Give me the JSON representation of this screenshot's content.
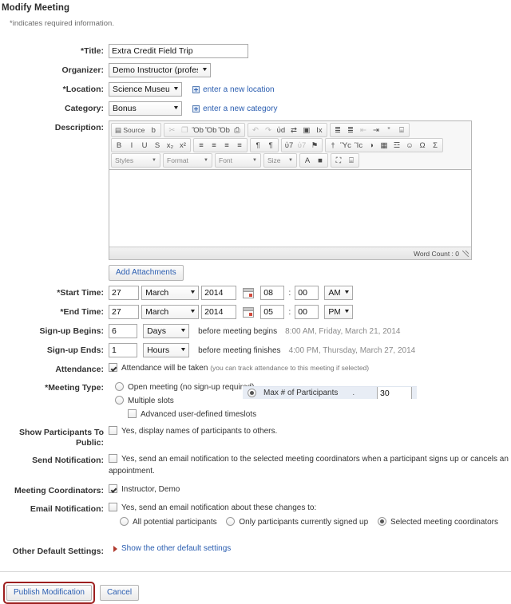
{
  "page": {
    "title": "Modify Meeting",
    "required_note_star": "*",
    "required_note": "indicates required information."
  },
  "fields": {
    "title": {
      "label": "Title:",
      "required": true,
      "value": "Extra Credit Field Trip"
    },
    "organizer": {
      "label": "Organizer:",
      "required": false,
      "value": "Demo Instructor (professor)"
    },
    "location": {
      "label": "Location:",
      "required": true,
      "value": "Science Museum",
      "add_link": "enter a new location",
      "add_icon": "plus-box-icon"
    },
    "category": {
      "label": "Category:",
      "required": false,
      "value": "Bonus",
      "add_link": "enter a new category",
      "add_icon": "plus-box-icon"
    },
    "description": {
      "label": "Description:",
      "required": false,
      "value": ""
    },
    "start_time": {
      "label": "Start Time:",
      "required": true,
      "day": "27",
      "month": "March",
      "year": "2014",
      "hour": "08",
      "minute": "00",
      "meridiem": "AM",
      "calendar_icon": "calendar-icon"
    },
    "end_time": {
      "label": "End Time:",
      "required": true,
      "day": "27",
      "month": "March",
      "year": "2014",
      "hour": "05",
      "minute": "00",
      "meridiem": "PM",
      "calendar_icon": "calendar-icon"
    },
    "signup_begins": {
      "label": "Sign-up Begins:",
      "required": false,
      "amount": "6",
      "unit": "Days",
      "suffix": "before meeting begins",
      "computed": "8:00 AM, Friday, March 21, 2014"
    },
    "signup_ends": {
      "label": "Sign-up Ends:",
      "required": false,
      "amount": "1",
      "unit": "Hours",
      "suffix": "before meeting finishes",
      "computed": "4:00 PM, Thursday, March 27, 2014"
    },
    "attendance": {
      "label": "Attendance:",
      "required": false,
      "checked": true,
      "text": "Attendance will be taken",
      "hint": "(you can track attendance to this meeting if selected)"
    },
    "meeting_type": {
      "label": "Meeting Type:",
      "required": true,
      "options": [
        {
          "text": "Open meeting (no sign-up required)",
          "selected": false
        },
        {
          "text": "Multiple slots",
          "selected": false
        }
      ],
      "advanced": {
        "text": "Advanced user-defined timeslots",
        "checked": false
      },
      "overlay": {
        "selected": true,
        "text": "Max # of Participants",
        "separator": ".",
        "value": "30"
      }
    },
    "show_participants": {
      "label": "Show Participants To Public:",
      "checked": false,
      "text": "Yes, display names of participants to others."
    },
    "send_notification": {
      "label": "Send Notification:",
      "checked": false,
      "text": "Yes, send an email notification to the selected meeting coordinators when a participant signs up or cancels an appointment."
    },
    "meeting_coordinators": {
      "label": "Meeting Coordinators:",
      "checked": true,
      "text": "Instructor, Demo"
    },
    "email_notification": {
      "label": "Email Notification:",
      "checked": false,
      "text": "Yes, send an email notification about these changes to:",
      "options": [
        {
          "text": "All potential participants",
          "selected": false
        },
        {
          "text": "Only participants currently signed up",
          "selected": false
        },
        {
          "text": "Selected meeting coordinators",
          "selected": true
        }
      ]
    },
    "other_defaults": {
      "label": "Other Default Settings:",
      "link": "Show the other default settings",
      "icon": "triangle-right-icon"
    }
  },
  "attachments": {
    "button": "Add Attachments"
  },
  "editor": {
    "word_count": "Word Count : 0",
    "toolbar": {
      "row1": [
        {
          "group": [
            {
              "name": "source-icon",
              "glyph": "▤",
              "label": "Source",
              "dim": false
            },
            {
              "name": "new-page-icon",
              "glyph": "὜b",
              "label": "",
              "dim": false
            }
          ]
        },
        {
          "group": [
            {
              "name": "cut-icon",
              "glyph": "✂",
              "label": "",
              "dim": true
            },
            {
              "name": "copy-icon",
              "glyph": "❐",
              "label": "",
              "dim": true
            },
            {
              "name": "paste-icon",
              "glyph": "Ὄb",
              "label": "",
              "dim": false
            },
            {
              "name": "paste-text-icon",
              "glyph": "Ὄb",
              "label": "",
              "dim": false
            },
            {
              "name": "paste-word-icon",
              "glyph": "Ὄb",
              "label": "",
              "dim": false
            },
            {
              "name": "print-icon",
              "glyph": "⎙",
              "label": "",
              "dim": false
            }
          ]
        },
        {
          "group": [
            {
              "name": "undo-icon",
              "glyph": "↶",
              "label": "",
              "dim": true
            },
            {
              "name": "redo-icon",
              "glyph": "↷",
              "label": "",
              "dim": true
            },
            {
              "name": "find-icon",
              "glyph": "ὐd",
              "label": "",
              "dim": false
            },
            {
              "name": "replace-icon",
              "glyph": "⇄",
              "label": "",
              "dim": false
            },
            {
              "name": "select-all-icon",
              "glyph": "▣",
              "label": "",
              "dim": false
            },
            {
              "name": "remove-format-icon",
              "glyph": "Ix",
              "label": "",
              "dim": false
            }
          ]
        },
        {
          "group": [
            {
              "name": "numbered-list-icon",
              "glyph": "≣",
              "label": "",
              "dim": false
            },
            {
              "name": "bulleted-list-icon",
              "glyph": "≣",
              "label": "",
              "dim": false
            },
            {
              "name": "outdent-icon",
              "glyph": "⇤",
              "label": "",
              "dim": true
            },
            {
              "name": "indent-icon",
              "glyph": "⇥",
              "label": "",
              "dim": false
            },
            {
              "name": "blockquote-icon",
              "glyph": "”",
              "label": "",
              "dim": false
            },
            {
              "name": "div-container-icon",
              "glyph": "⌸",
              "label": "",
              "dim": false
            }
          ]
        }
      ],
      "row2": [
        {
          "group": [
            {
              "name": "bold-icon",
              "glyph": "B",
              "label": "",
              "dim": false
            },
            {
              "name": "italic-icon",
              "glyph": "I",
              "label": "",
              "dim": false
            },
            {
              "name": "underline-icon",
              "glyph": "U",
              "label": "",
              "dim": false
            },
            {
              "name": "strikethrough-icon",
              "glyph": "S",
              "label": "",
              "dim": false
            },
            {
              "name": "subscript-icon",
              "glyph": "x₂",
              "label": "",
              "dim": false
            },
            {
              "name": "superscript-icon",
              "glyph": "x²",
              "label": "",
              "dim": false
            }
          ]
        },
        {
          "group": [
            {
              "name": "align-left-icon",
              "glyph": "≡",
              "label": "",
              "dim": false
            },
            {
              "name": "align-center-icon",
              "glyph": "≡",
              "label": "",
              "dim": false
            },
            {
              "name": "align-right-icon",
              "glyph": "≡",
              "label": "",
              "dim": false
            },
            {
              "name": "justify-icon",
              "glyph": "≡",
              "label": "",
              "dim": false
            }
          ]
        },
        {
          "group": [
            {
              "name": "text-direction-ltr-icon",
              "glyph": "¶",
              "label": "",
              "dim": false
            },
            {
              "name": "text-direction-rtl-icon",
              "glyph": "¶",
              "label": "",
              "dim": false
            }
          ]
        },
        {
          "group": [
            {
              "name": "link-icon",
              "glyph": "ὑ7",
              "label": "",
              "dim": false
            },
            {
              "name": "unlink-icon",
              "glyph": "ὑ7",
              "label": "",
              "dim": true
            },
            {
              "name": "anchor-icon",
              "glyph": "⚑",
              "label": "",
              "dim": false
            }
          ]
        },
        {
          "group": [
            {
              "name": "insert-citation-icon",
              "glyph": "†",
              "label": "",
              "dim": false
            },
            {
              "name": "insert-image-icon",
              "glyph": "Ὓc",
              "label": "",
              "dim": false
            },
            {
              "name": "insert-flash-icon",
              "glyph": "Ἲc",
              "label": "",
              "dim": false
            },
            {
              "name": "insert-media-icon",
              "glyph": "◑",
              "label": "",
              "dim": false
            },
            {
              "name": "insert-table-icon",
              "glyph": "▦",
              "label": "",
              "dim": false
            },
            {
              "name": "horizontal-rule-icon",
              "glyph": "☲",
              "label": "",
              "dim": false
            },
            {
              "name": "smiley-icon",
              "glyph": "☺",
              "label": "",
              "dim": false
            },
            {
              "name": "special-char-icon",
              "glyph": "Ω",
              "label": "",
              "dim": false
            },
            {
              "name": "math-icon",
              "glyph": "Σ",
              "label": "",
              "dim": false
            }
          ]
        }
      ],
      "row3_combos": [
        {
          "name": "styles-combo",
          "label": "Styles"
        },
        {
          "name": "format-combo",
          "label": "Format"
        },
        {
          "name": "font-combo",
          "label": "Font"
        },
        {
          "name": "size-combo",
          "label": "Size"
        }
      ],
      "row3_buttons": [
        {
          "group": [
            {
              "name": "text-color-icon",
              "glyph": "A",
              "label": "",
              "dim": false
            },
            {
              "name": "background-color-icon",
              "glyph": "■",
              "label": "",
              "dim": false
            }
          ]
        },
        {
          "group": [
            {
              "name": "maximize-icon",
              "glyph": "⛶",
              "label": "",
              "dim": false
            },
            {
              "name": "show-blocks-icon",
              "glyph": "⌸",
              "label": "",
              "dim": false
            }
          ]
        }
      ]
    }
  },
  "footer": {
    "publish_label": "Publish Modification",
    "cancel_label": "Cancel",
    "highlight_color": "#9d1f1f"
  },
  "colors": {
    "link": "#2a5db0",
    "muted": "#8a8a8a",
    "label": "#333333",
    "overlay_bg": "#e8edf5"
  }
}
